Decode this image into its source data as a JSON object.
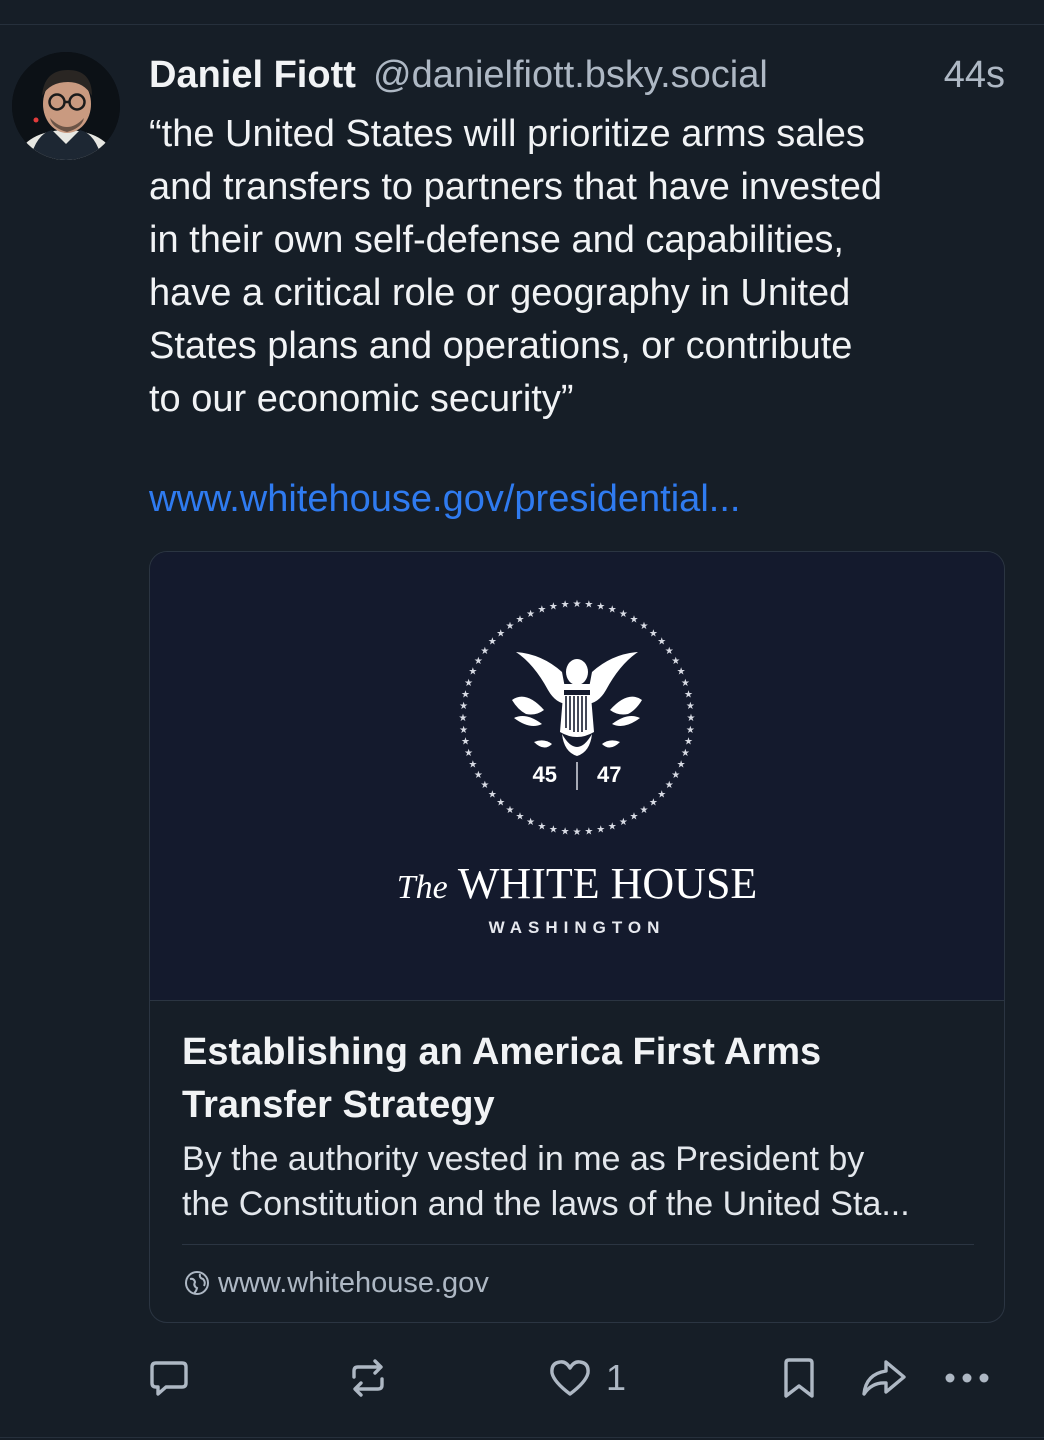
{
  "post": {
    "author": {
      "display_name": "Daniel Fiott",
      "handle": "@danielfiott.bsky.social"
    },
    "time_ago": "44s",
    "text_lines": [
      "“the United States will prioritize arms sales",
      "and transfers to partners that have invested",
      "in their own self-defense and capabilities,",
      "have a critical role or geography in United",
      "States plans and operations, or contribute",
      "to our economic security”"
    ],
    "link_text": "www.whitehouse.gov/presidential..."
  },
  "card": {
    "image": {
      "seal_left_number": "45",
      "seal_right_number": "47",
      "title_prefix": "The",
      "title_main": "WHITE HOUSE",
      "subtitle": "WASHINGTON"
    },
    "title_lines": [
      "Establishing an America First Arms",
      "Transfer Strategy"
    ],
    "description_lines": [
      "By the authority vested in me as President by",
      "the Constitution and the laws of the United Sta..."
    ],
    "domain": "www.whitehouse.gov",
    "domain_icon": "globe-icon"
  },
  "actions": {
    "like_count": "1",
    "icons": [
      "reply-icon",
      "repost-icon",
      "like-icon",
      "bookmark-icon",
      "share-icon",
      "more-icon"
    ]
  },
  "colors": {
    "background": "#161e27",
    "link": "#2f7bf0",
    "muted": "#aeb8c4",
    "card_image_bg": "#141a2d"
  }
}
